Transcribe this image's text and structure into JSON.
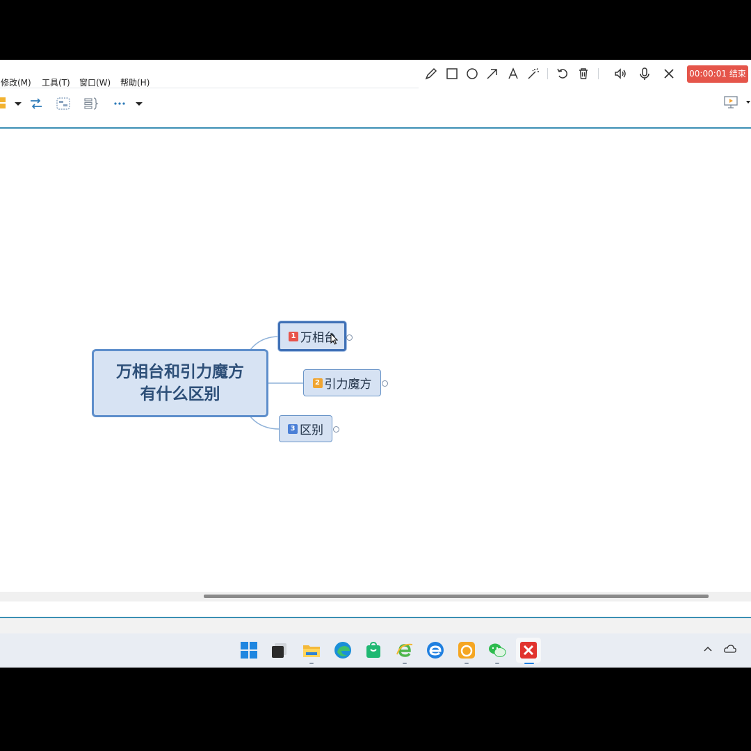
{
  "menu": {
    "items": [
      {
        "label": "修改(M)"
      },
      {
        "label": "工具(T)"
      },
      {
        "label": "窗口(W)"
      },
      {
        "label": "帮助(H)"
      }
    ]
  },
  "recorder": {
    "icons": [
      "pencil-icon",
      "rectangle-icon",
      "circle-icon",
      "arrow-icon",
      "text-icon",
      "magic-wand-icon",
      "undo-icon",
      "delete-icon",
      "speaker-icon",
      "microphone-icon",
      "close-icon"
    ],
    "timer": "00:00:01",
    "end_label": "结束",
    "end_color": "#e5554a"
  },
  "mindmap": {
    "central_topic": {
      "line1": "万相台和引力魔方",
      "line2": "有什么区别"
    },
    "topics": [
      {
        "number": "1",
        "label": "万相台",
        "badge_color": "#e8534a"
      },
      {
        "number": "2",
        "label": "引力魔方",
        "badge_color": "#f0a531"
      },
      {
        "number": "3",
        "label": "区别",
        "badge_color": "#4a7fd6"
      }
    ]
  },
  "theme": {
    "accent": "#3b8fb4",
    "node_fill": "#d6e2f3",
    "node_border": "#5d8ecb"
  },
  "taskbar": {
    "icons": [
      "windows-start-icon",
      "task-view-icon",
      "file-explorer-icon",
      "edge-browser-icon",
      "store-bag-icon",
      "ie-browser-icon",
      "edge-legacy-icon",
      "uc-browser-icon",
      "wechat-icon",
      "xmind-icon"
    ],
    "tray": [
      "chevron-up-icon",
      "onedrive-cloud-icon"
    ]
  }
}
